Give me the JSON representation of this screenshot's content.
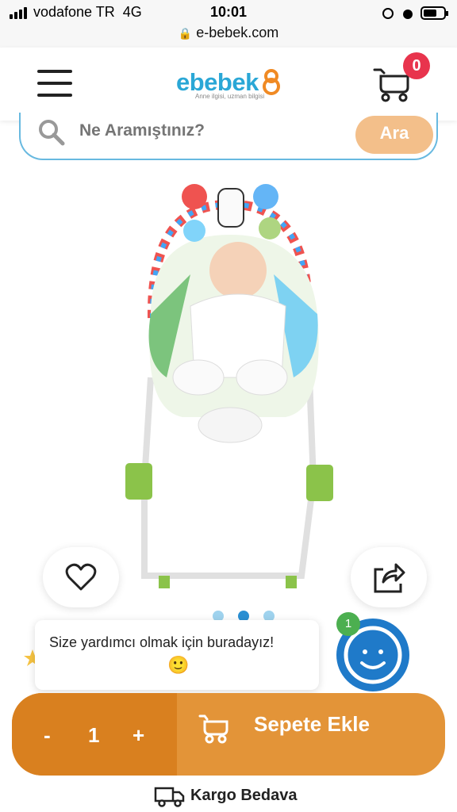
{
  "status_bar": {
    "carrier": "vodafone TR",
    "network": "4G",
    "time": "10:01",
    "url": "e-bebek.com"
  },
  "header": {
    "logo_text": "ebebek",
    "logo_tagline": "Anne ilgisi, uzman bilgisi",
    "cart_count": "0"
  },
  "search": {
    "placeholder": "Ne Aramıştınız?",
    "button_label": "Ara"
  },
  "product": {
    "image_alt": "baby bouncer",
    "carousel_dots": 3,
    "active_dot": 1
  },
  "chat": {
    "message": "Size yardımcı olmak için buradayız!",
    "emoji": "🙂",
    "unread": "1"
  },
  "cart_bar": {
    "minus": "-",
    "quantity": "1",
    "plus": "+",
    "add_label": "Sepete Ekle"
  },
  "shipping": {
    "label": "Kargo Bedava"
  },
  "colors": {
    "accent_blue": "#2aa7d6",
    "orange": "#e39438",
    "orange_dark": "#d9801f",
    "badge_red": "#e8344d"
  }
}
